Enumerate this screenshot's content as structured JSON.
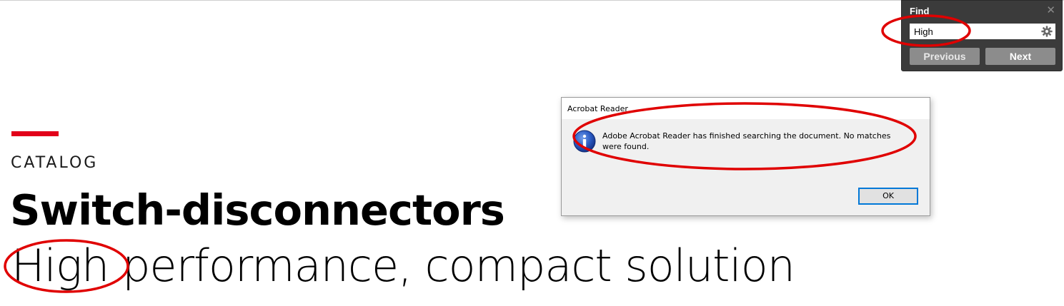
{
  "document": {
    "eyebrow": "CATALOG",
    "title": "Switch-disconnectors",
    "subtitle_highlight": "High",
    "subtitle_rest": " performance, compact solution"
  },
  "find_panel": {
    "title": "Find",
    "close_icon": "close-icon",
    "query": "High",
    "settings_icon": "gear-icon",
    "previous_label": "Previous",
    "next_label": "Next"
  },
  "dialog": {
    "title": "Acrobat Reader",
    "icon": "info-icon",
    "message": "Adobe Acrobat Reader has finished searching the document. No matches were found.",
    "ok_label": "OK"
  },
  "colors": {
    "brand_red": "#e2001a",
    "annotation_red": "#e00000",
    "find_panel_bg": "#3b3b3b",
    "dialog_bg": "#f0f0f0",
    "button_focus_blue": "#0078d7"
  }
}
